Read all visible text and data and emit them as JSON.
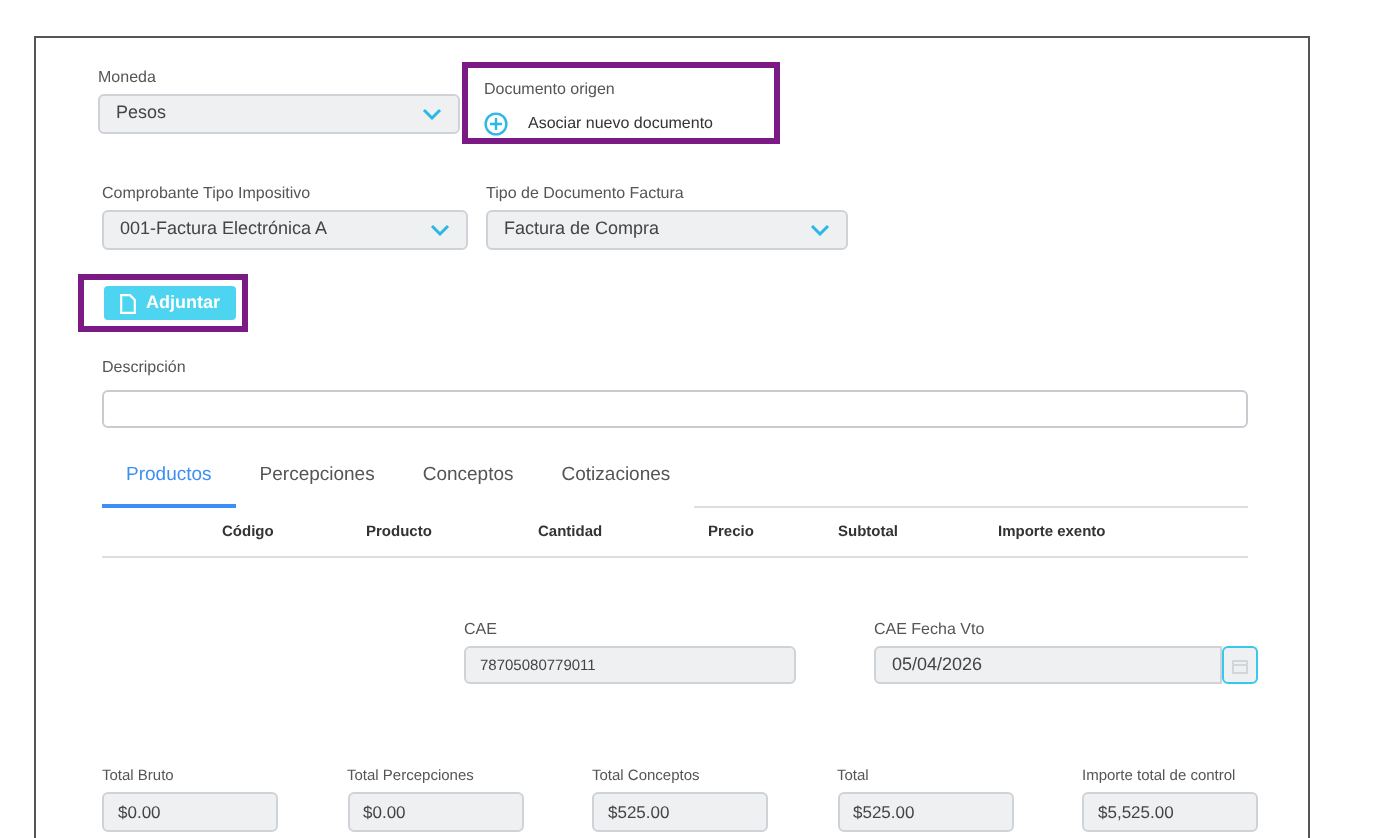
{
  "moneda": {
    "label": "Moneda",
    "value": "Pesos"
  },
  "documento_origen": {
    "label": "Documento origen",
    "action": "Asociar nuevo documento",
    "highlighted": true
  },
  "comprobante_tipo": {
    "label": "Comprobante Tipo Impositivo",
    "value": "001-Factura Electrónica A"
  },
  "tipo_documento": {
    "label": "Tipo de Documento Factura",
    "value": "Factura de Compra"
  },
  "adjuntar": {
    "label": "Adjuntar",
    "highlighted": true
  },
  "descripcion": {
    "label": "Descripción"
  },
  "tabs": [
    {
      "label": "Productos",
      "selected": true
    },
    {
      "label": "Percepciones",
      "selected": false
    },
    {
      "label": "Conceptos",
      "selected": false
    },
    {
      "label": "Cotizaciones",
      "selected": false
    }
  ],
  "table": {
    "columns": [
      "Código",
      "Producto",
      "Cantidad",
      "Precio",
      "Subtotal",
      "Importe exento"
    ]
  },
  "cae": {
    "label": "CAE",
    "value": "78705080779011"
  },
  "cae_fecha": {
    "label": "CAE Fecha Vto",
    "value": "05/04/2026"
  },
  "totals": [
    {
      "label": "Total Bruto",
      "value": "$0.00"
    },
    {
      "label": "Total Percepciones",
      "value": "$0.00"
    },
    {
      "label": "Total Conceptos",
      "value": "$525.00"
    },
    {
      "label": "Total",
      "value": "$525.00"
    },
    {
      "label": "Importe total de control",
      "value": "$5,525.00"
    }
  ]
}
